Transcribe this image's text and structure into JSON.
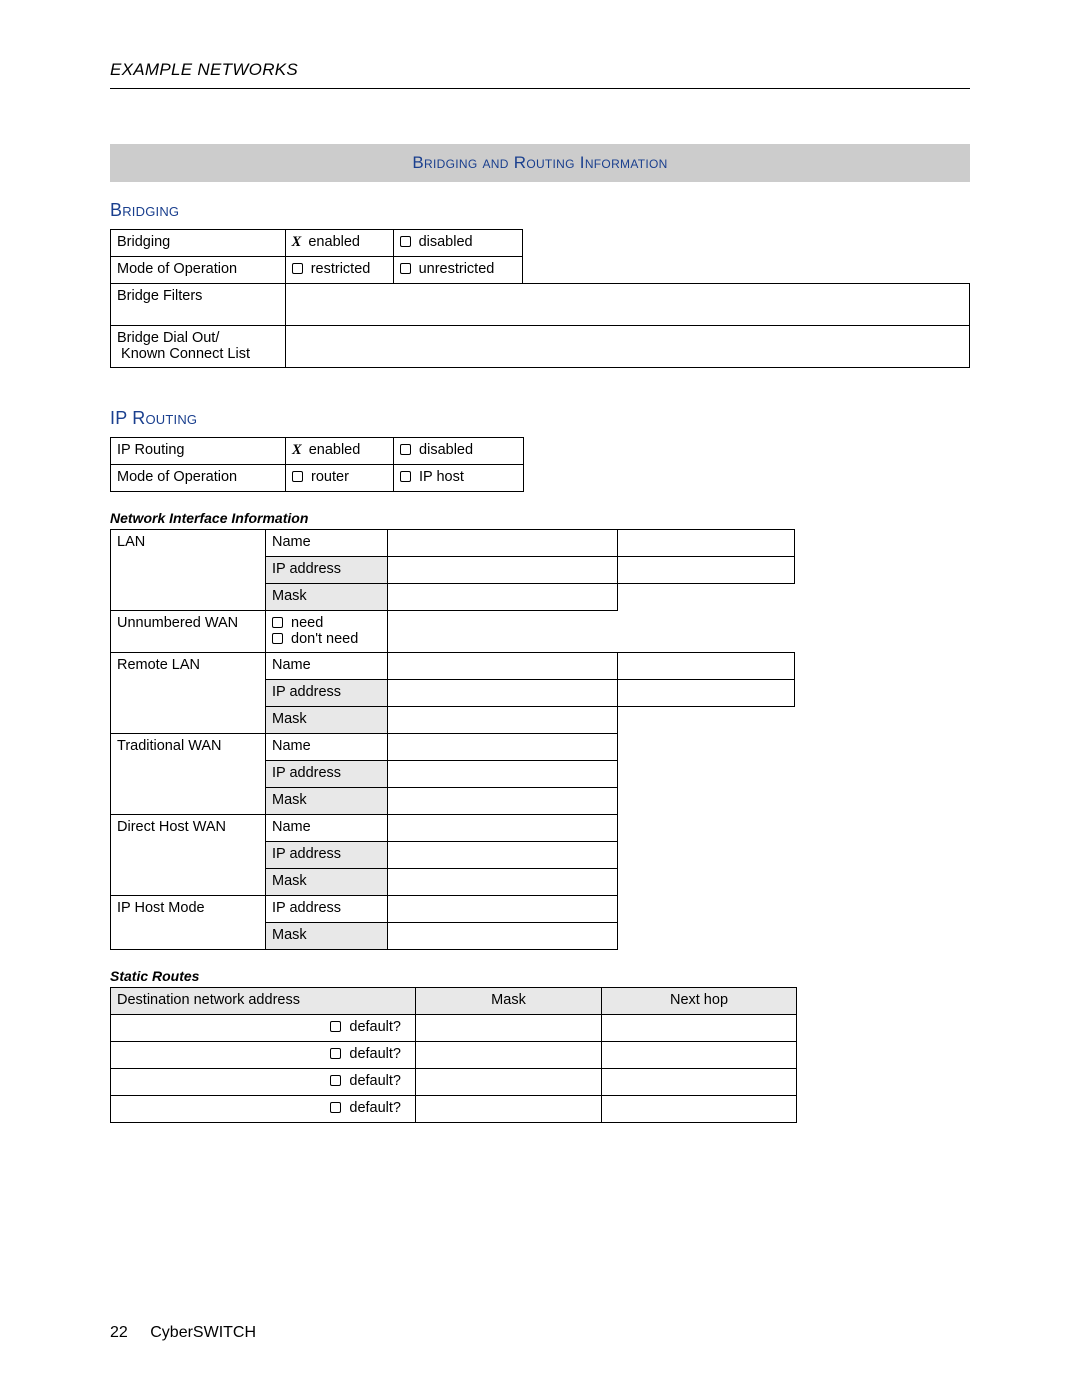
{
  "header": "EXAMPLE NETWORKS",
  "section_bar": "Bridging and Routing Information",
  "bridging": {
    "heading": "Bridging",
    "rows": [
      {
        "label": "Bridging",
        "opt1_marked": true,
        "opt1": "enabled",
        "opt2": "disabled"
      },
      {
        "label": "Mode of Operation",
        "opt1_marked": false,
        "opt1": "restricted",
        "opt2": "unrestricted"
      }
    ],
    "wide_rows": [
      "Bridge Filters",
      "Bridge Dial Out/ Known Connect List"
    ]
  },
  "iprouting": {
    "heading": "IP Routing",
    "rows": [
      {
        "label": "IP Routing",
        "opt1_marked": true,
        "opt1": "enabled",
        "opt2": "disabled"
      },
      {
        "label": "Mode of Operation",
        "opt1_marked": false,
        "opt1": "router",
        "opt2": "IP host"
      }
    ]
  },
  "nib": {
    "title": "Network Interface Information",
    "groups": [
      {
        "label": "LAN",
        "fields": [
          "Name",
          "IP address",
          "Mask"
        ],
        "shade_2nd": true,
        "cols4": [
          true,
          true,
          false
        ]
      },
      {
        "label": "Unnumbered WAN",
        "need_block": true,
        "opt_need": "need",
        "opt_dont": "don't need"
      },
      {
        "label": "Remote LAN",
        "fields": [
          "Name",
          "IP address",
          "Mask"
        ],
        "cols4": [
          true,
          true,
          false
        ]
      },
      {
        "label": "Traditional WAN",
        "fields": [
          "Name",
          "IP address",
          "Mask"
        ],
        "cols4": [
          false,
          false,
          false
        ]
      },
      {
        "label": "Direct Host WAN",
        "fields": [
          "Name",
          "IP address",
          "Mask"
        ],
        "cols4": [
          false,
          false,
          false
        ]
      },
      {
        "label": "IP Host Mode",
        "fields": [
          "IP address",
          "Mask"
        ],
        "cols4": [
          false,
          false
        ]
      }
    ]
  },
  "static_routes": {
    "title": "Static Routes",
    "headers": [
      "Destination network address",
      "Mask",
      "Next hop"
    ],
    "default_label": "default?",
    "row_count": 4
  },
  "footer": {
    "page": "22",
    "product": "CyberSWITCH"
  }
}
